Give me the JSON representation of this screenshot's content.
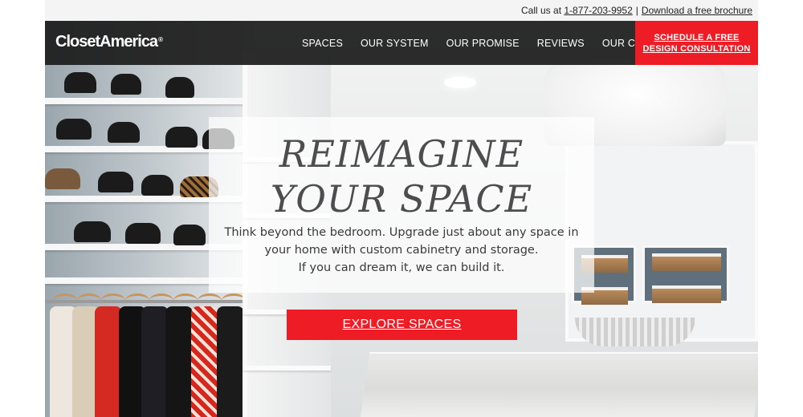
{
  "utility": {
    "call_prefix": "Call us at",
    "phone": "1-877-203-9952",
    "separator": "|",
    "brochure_link": "Download a free brochure"
  },
  "brand": {
    "logo_text": "ClosetAmerica",
    "registered_mark": "®"
  },
  "nav": {
    "items": [
      {
        "label": "SPACES"
      },
      {
        "label": "OUR SYSTEM"
      },
      {
        "label": "OUR PROMISE"
      },
      {
        "label": "REVIEWS"
      },
      {
        "label": "OUR COMPANY"
      }
    ],
    "cta_label": "SCHEDULE A FREE DESIGN CONSULTATION"
  },
  "hero": {
    "headline_line1": "REIMAGINE",
    "headline_line2": "YOUR SPACE",
    "tagline_line1": "Think beyond the bedroom. Upgrade just about any space in",
    "tagline_line2": "your home with custom cabinetry and storage.",
    "tagline_line3": "If you can dream it, we can build it.",
    "button_label": "EXPLORE SPACES"
  },
  "colors": {
    "accent_red": "#ee1c25",
    "nav_background": "#1c1c1c",
    "headline_gray": "#4d4d4f"
  }
}
